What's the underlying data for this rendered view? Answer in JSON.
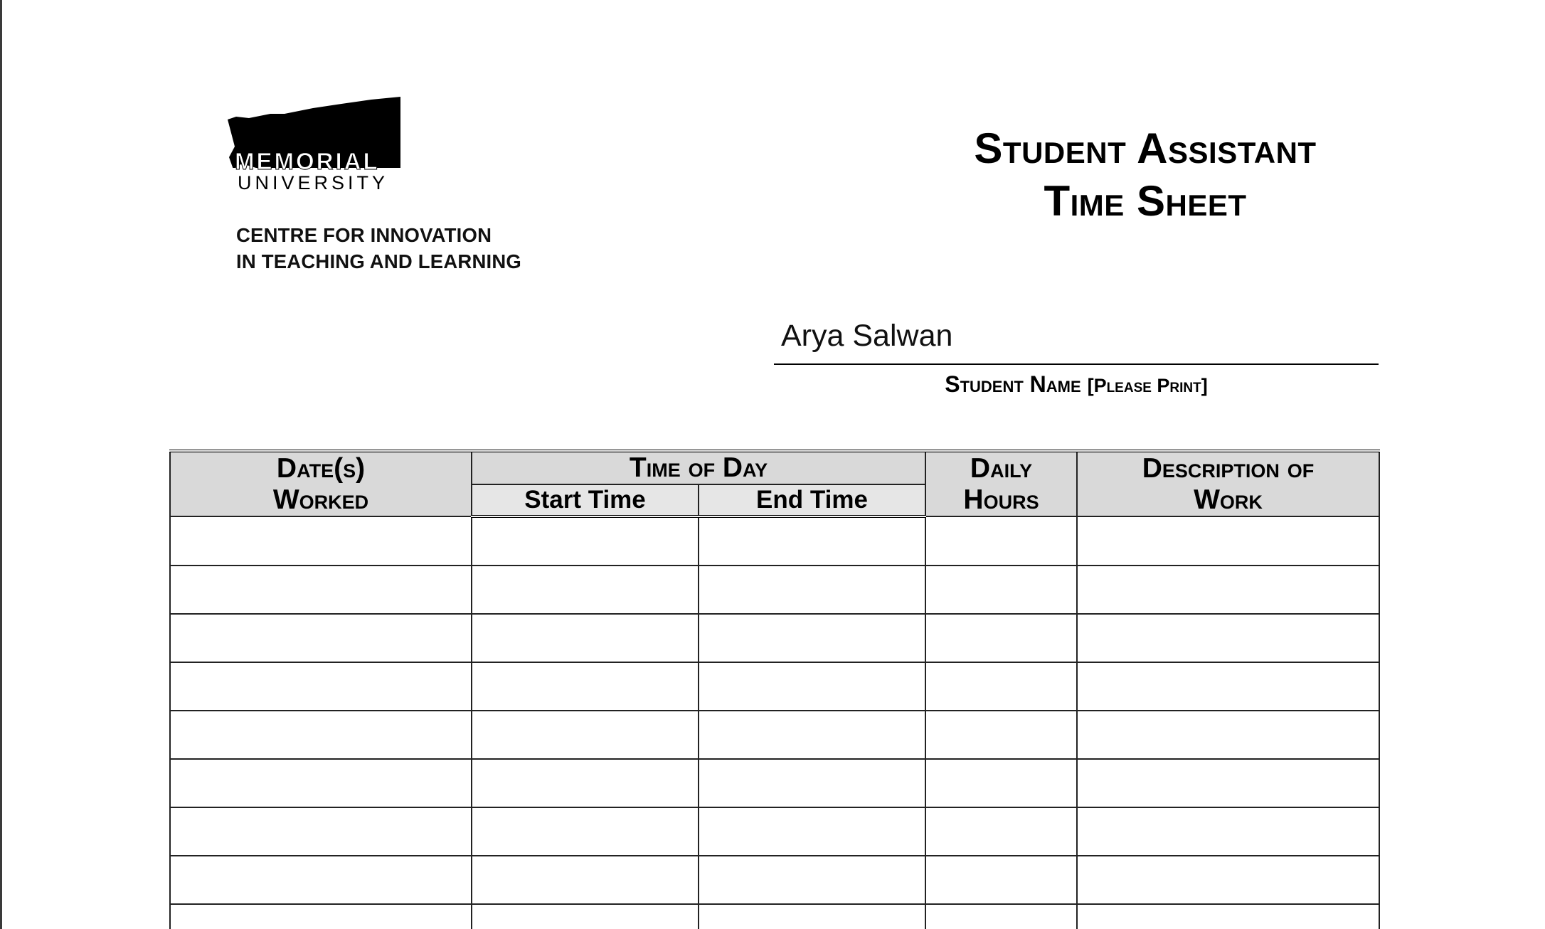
{
  "logo": {
    "brand": "MEMORIAL",
    "subbrand": "UNIVERSITY"
  },
  "unit": {
    "line1": "CENTRE FOR INNOVATION",
    "line2": "IN TEACHING AND LEARNING"
  },
  "title": {
    "line1": "Student Assistant",
    "line2": "Time Sheet"
  },
  "student": {
    "name": "Arya Salwan",
    "caption_main": "Student Name ",
    "caption_note": "[Please Print]"
  },
  "table": {
    "col_dates_line1": "Date(s)",
    "col_dates_line2": "Worked",
    "group_time": "Time of Day",
    "col_start": "Start Time",
    "col_end": "End Time",
    "col_hours_line1": "Daily",
    "col_hours_line2": "Hours",
    "col_desc_line1": "Description of",
    "col_desc_line2": "Work",
    "empty_rows": 9
  }
}
